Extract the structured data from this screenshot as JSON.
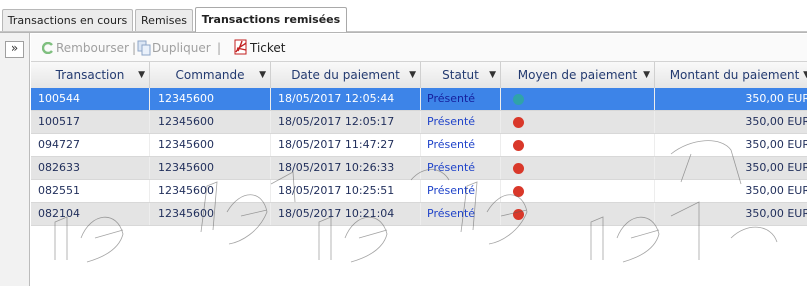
{
  "tabs": [
    {
      "label": "Transactions en cours",
      "active": false
    },
    {
      "label": "Remises",
      "active": false
    },
    {
      "label": "Transactions remisées",
      "active": true
    }
  ],
  "sidebar": {
    "collapse_icon": "»"
  },
  "toolbar": {
    "refund_label": "Rembourser",
    "duplicate_label": "Dupliquer",
    "ticket_label": "Ticket",
    "separator": "|"
  },
  "columns": [
    "Transaction",
    "Commande",
    "Date du paiement",
    "Statut",
    "Moyen de paiement",
    "Montant du paiement"
  ],
  "rows": [
    {
      "transaction": "100544",
      "order": "12345600",
      "date": "18/05/2017 12:05:44",
      "status": "Présenté",
      "payment_icon": "card-teal-icon",
      "amount": "350,00 EUR",
      "selected": true
    },
    {
      "transaction": "100517",
      "order": "12345600",
      "date": "18/05/2017 12:05:17",
      "status": "Présenté",
      "payment_icon": "card-red-icon",
      "amount": "350,00 EUR",
      "selected": false
    },
    {
      "transaction": "094727",
      "order": "12345600",
      "date": "18/05/2017 11:47:27",
      "status": "Présenté",
      "payment_icon": "card-red-icon",
      "amount": "350,00 EUR",
      "selected": false
    },
    {
      "transaction": "082633",
      "order": "12345600",
      "date": "18/05/2017 10:26:33",
      "status": "Présenté",
      "payment_icon": "card-red-icon",
      "amount": "350,00 EUR",
      "selected": false
    },
    {
      "transaction": "082551",
      "order": "12345600",
      "date": "18/05/2017 10:25:51",
      "status": "Présenté",
      "payment_icon": "card-red-icon",
      "amount": "350,00 EUR",
      "selected": false
    },
    {
      "transaction": "082104",
      "order": "12345600",
      "date": "18/05/2017 10:21:04",
      "status": "Présenté",
      "payment_icon": "card-red-icon",
      "amount": "350,00 EUR",
      "selected": false
    }
  ],
  "colors": {
    "selected_row": "#3d84e8",
    "alt_row": "#e4e4e4",
    "status_text": "#1f43c9",
    "card_red": "#d9382a",
    "card_teal": "#2fa3a9"
  }
}
